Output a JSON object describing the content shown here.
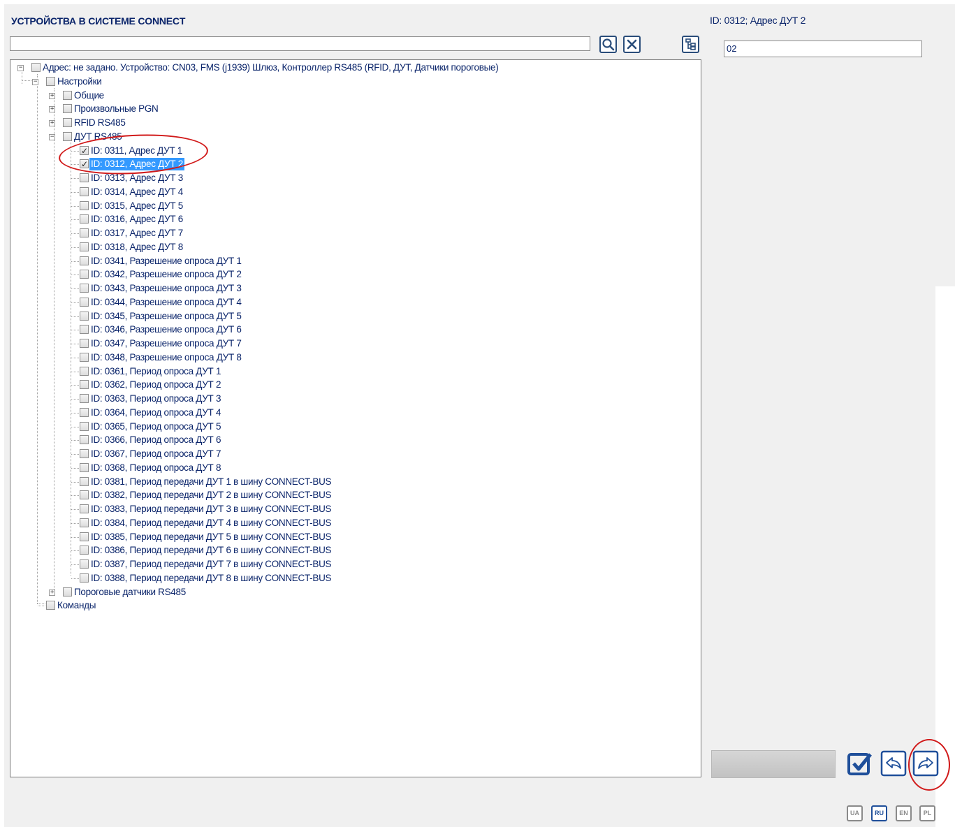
{
  "title": "УСТРОЙСТВА В СИСТЕМЕ CONNECT",
  "search": {
    "value": "",
    "placeholder": ""
  },
  "toolbar": {
    "search_icon": "magnifier-icon",
    "clear_icon": "close-icon",
    "tree_icon": "tree-structure-icon"
  },
  "tree": {
    "root": "Адрес: не задано. Устройство: CN03, FMS (j1939) Шлюз, Контроллер RS485 (RFID, ДУТ, Датчики пороговые)",
    "settings": "Настройки",
    "groups": [
      "Общие",
      "Произвольные PGN",
      "RFID RS485",
      "ДУТ RS485"
    ],
    "items": [
      "ID: 0311, Адрес ДУТ 1",
      "ID: 0312, Адрес ДУТ 2",
      "ID: 0313, Адрес ДУТ 3",
      "ID: 0314, Адрес ДУТ 4",
      "ID: 0315, Адрес ДУТ 5",
      "ID: 0316, Адрес ДУТ 6",
      "ID: 0317, Адрес ДУТ 7",
      "ID: 0318, Адрес ДУТ 8",
      "ID: 0341, Разрешение опроса ДУТ 1",
      "ID: 0342, Разрешение опроса ДУТ 2",
      "ID: 0343, Разрешение опроса ДУТ 3",
      "ID: 0344, Разрешение опроса ДУТ 4",
      "ID: 0345, Разрешение опроса ДУТ 5",
      "ID: 0346, Разрешение опроса ДУТ 6",
      "ID: 0347, Разрешение опроса ДУТ 7",
      "ID: 0348, Разрешение опроса ДУТ 8",
      "ID: 0361, Период опроса ДУТ 1",
      "ID: 0362, Период опроса ДУТ 2",
      "ID: 0363, Период опроса ДУТ 3",
      "ID: 0364, Период опроса ДУТ 4",
      "ID: 0365, Период опроса ДУТ 5",
      "ID: 0366, Период опроса ДУТ 6",
      "ID: 0367, Период опроса ДУТ 7",
      "ID: 0368, Период опроса ДУТ 8",
      "ID: 0381, Период передачи ДУТ 1 в шину CONNECT-BUS",
      "ID: 0382, Период передачи ДУТ 2 в шину CONNECT-BUS",
      "ID: 0383, Период передачи ДУТ 3 в шину CONNECT-BUS",
      "ID: 0384, Период передачи ДУТ 4 в шину CONNECT-BUS",
      "ID: 0385, Период передачи ДУТ 5 в шину CONNECT-BUS",
      "ID: 0386, Период передачи ДУТ 6 в шину CONNECT-BUS",
      "ID: 0387, Период передачи ДУТ 7 в шину CONNECT-BUS",
      "ID: 0388, Период передачи ДУТ 8 в шину CONNECT-BUS"
    ],
    "checked_items": [
      "ID: 0311, Адрес ДУТ 1",
      "ID: 0312, Адрес ДУТ 2"
    ],
    "selected_item": "ID: 0312, Адрес ДУТ 2",
    "threshold": "Пороговые датчики RS485",
    "commands": "Команды"
  },
  "details": {
    "header": "ID: 0312; Адрес ДУТ 2",
    "value": "02"
  },
  "actions": {
    "apply_icon": "checkmark-icon",
    "back_icon": "share-back-icon",
    "forward_icon": "share-forward-icon"
  },
  "languages": [
    "UA",
    "RU",
    "EN",
    "PL"
  ],
  "active_language": "RU",
  "colors": {
    "text": "#0a246a",
    "selection": "#3399ff",
    "annotation": "#d11a1a",
    "panel_bg": "#f0f0f0"
  }
}
